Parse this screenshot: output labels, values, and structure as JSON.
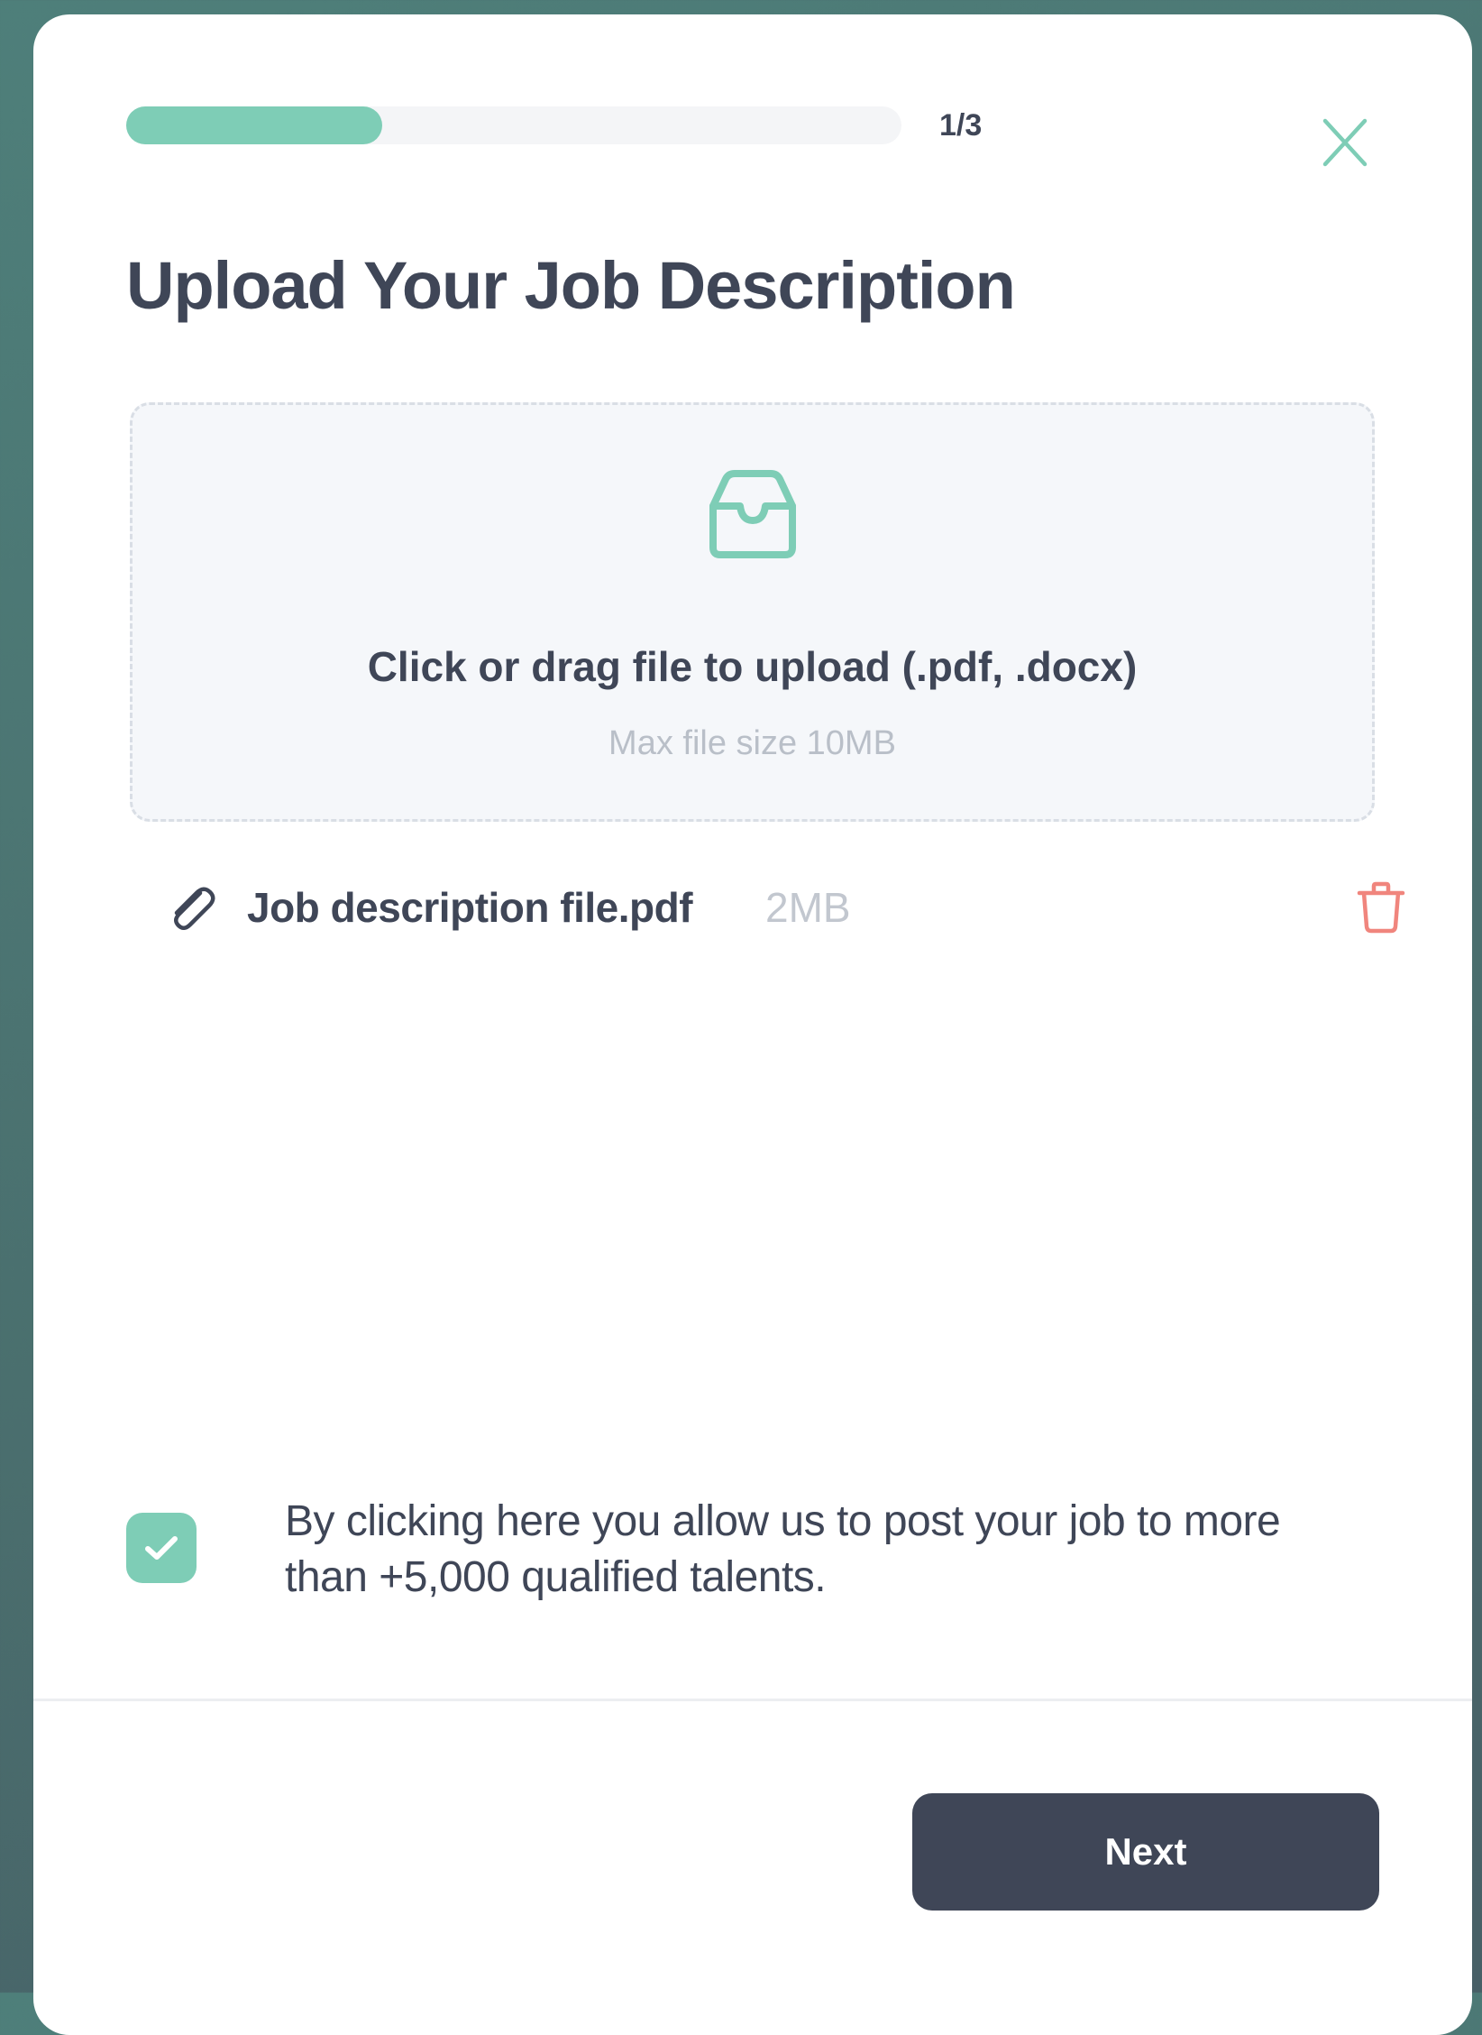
{
  "progress": {
    "step_label": "1/3",
    "fraction": 0.33,
    "fill_color": "#7ecdb6"
  },
  "header": {
    "close_icon": "close-icon"
  },
  "title": "Upload Your Job Description",
  "dropzone": {
    "icon": "inbox-icon",
    "title": "Click or drag file to upload (.pdf, .docx)",
    "hint": "Max file size 10MB"
  },
  "file": {
    "icon": "paperclip-icon",
    "name": "Job description file.pdf",
    "size": "2MB",
    "delete_icon": "trash-icon"
  },
  "consent": {
    "checked": true,
    "text": "By clicking here you allow us to post your job to more than +5,000 qualified talents."
  },
  "footer": {
    "next_label": "Next"
  },
  "colors": {
    "accent": "#7ecdb6",
    "text_primary": "#3f4657",
    "danger": "#f0857d",
    "button_bg": "#3f4657"
  }
}
